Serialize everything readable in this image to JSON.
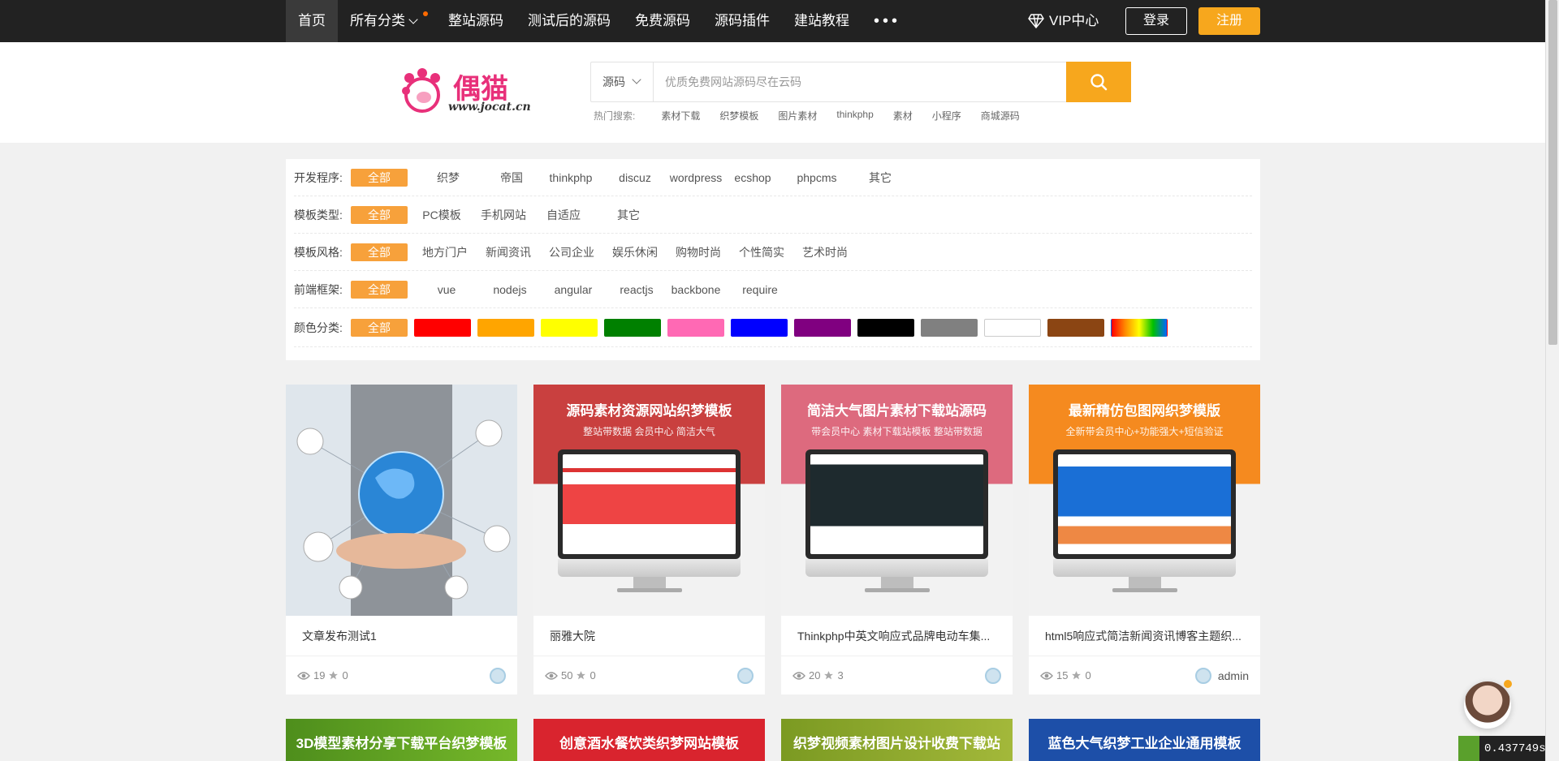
{
  "nav": {
    "items": [
      "首页",
      "所有分类",
      "整站源码",
      "测试后的源码",
      "免费源码",
      "源码插件",
      "建站教程"
    ],
    "more": "•••",
    "vip": "VIP中心",
    "login": "登录",
    "register": "注册"
  },
  "logo": {
    "text": "偶猫",
    "url": "www.jocat.cn"
  },
  "search": {
    "type": "源码",
    "placeholder": "优质免费网站源码尽在云码",
    "hot_label": "热门搜索:",
    "hot": [
      "素材下载",
      "织梦模板",
      "图片素材",
      "thinkphp",
      "素材",
      "小程序",
      "商城源码"
    ]
  },
  "filters": [
    {
      "label": "开发程序:",
      "options": [
        "全部",
        "织梦",
        "帝国",
        "thinkphp",
        "discuz",
        "wordpress",
        "ecshop",
        "phpcms",
        "其它"
      ]
    },
    {
      "label": "模板类型:",
      "options": [
        "全部",
        "PC模板",
        "手机网站",
        "自适应",
        "其它"
      ]
    },
    {
      "label": "模板风格:",
      "options": [
        "全部",
        "地方门户",
        "新闻资讯",
        "公司企业",
        "娱乐休闲",
        "购物时尚",
        "个性简实",
        "艺术时尚"
      ]
    },
    {
      "label": "前端框架:",
      "options": [
        "全部",
        "vue",
        "nodejs",
        "angular",
        "reactjs",
        "backbone",
        "require"
      ]
    }
  ],
  "colors": {
    "label": "颜色分类:",
    "all": "全部",
    "swatches": [
      "#ff0000",
      "#ffa500",
      "#ffff00",
      "#008000",
      "#ff69b4",
      "#0000ff",
      "#800080",
      "#000000",
      "#808080",
      "#ffffff",
      "#8b4513",
      "rainbow"
    ]
  },
  "cards": [
    {
      "title": "文章发布测试1",
      "views": "19",
      "stars": "0",
      "author": ""
    },
    {
      "title": "丽雅大院",
      "views": "50",
      "stars": "0",
      "author": "",
      "banner_title": "源码素材资源网站织梦模板",
      "banner_sub": "整站带数据 会员中心 简洁大气",
      "color": "#d9534f"
    },
    {
      "title": "Thinkphp中英文响应式品牌电动车集...",
      "views": "20",
      "stars": "3",
      "author": "",
      "banner_title": "简洁大气图片素材下载站源码",
      "banner_sub": "带会员中心 素材下载站模板 整站带数据",
      "color": "#e0607a"
    },
    {
      "title": "html5响应式简洁新闻资讯博客主题织...",
      "views": "15",
      "stars": "0",
      "author": "admin",
      "banner_title": "最新精仿包图网织梦模版",
      "banner_sub": "全新带会员中心+功能强大+短信验证",
      "color": "#f7931e"
    }
  ],
  "bottom_cards": [
    {
      "title": "3D模型素材分享下载平台织梦模板",
      "color": "#5a9e1f"
    },
    {
      "title": "创意酒水餐饮类织梦网站模板",
      "color": "#d9242e"
    },
    {
      "title": "织梦视频素材图片设计收费下载站",
      "color": "#8aa62a"
    },
    {
      "title": "蓝色大气织梦工业企业通用模板",
      "color": "#1d4fa8"
    }
  ],
  "timer": "0.437749s"
}
